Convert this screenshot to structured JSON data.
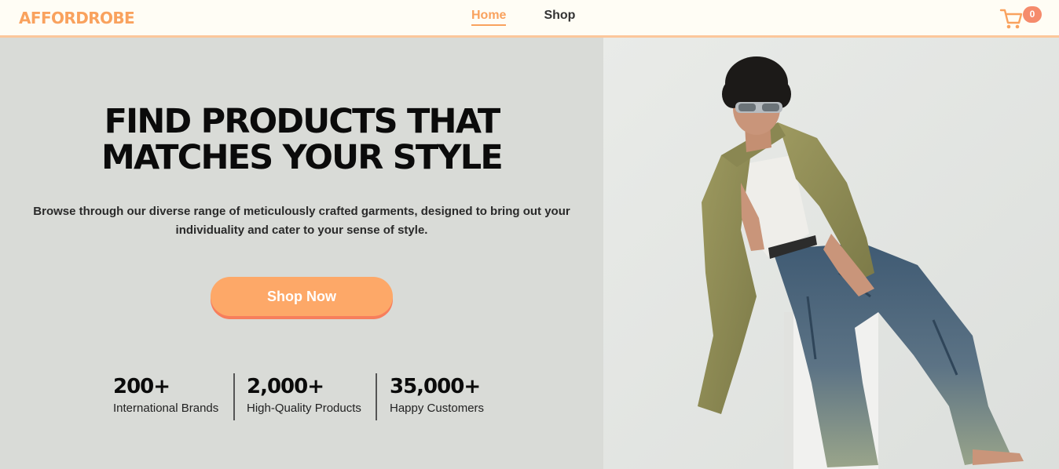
{
  "brand": "AFFORDROBE",
  "nav": {
    "links": [
      {
        "label": "Home",
        "active": true
      },
      {
        "label": "Shop",
        "active": false
      }
    ],
    "cart": {
      "icon": "cart-icon",
      "count": "0"
    }
  },
  "hero": {
    "title_line1": "FIND PRODUCTS THAT",
    "title_line2": "MATCHES YOUR STYLE",
    "subtitle_line1": "Browse through our diverse range of meticulously crafted garments, designed to bring out your",
    "subtitle_line2": "individuality and cater to your sense of style.",
    "cta_label": "Shop Now"
  },
  "stats": [
    {
      "value": "200+",
      "label": "International Brands"
    },
    {
      "value": "2,000+",
      "label": "High-Quality Products"
    },
    {
      "value": "35,000+",
      "label": "Happy Customers"
    }
  ],
  "colors": {
    "accent": "#f9a25e",
    "button": "#fda868",
    "button_shadow": "#f77e5c",
    "badge": "#f58b6c",
    "hero_bg": "#d9dbd7",
    "nav_bg": "#fffdf5"
  }
}
